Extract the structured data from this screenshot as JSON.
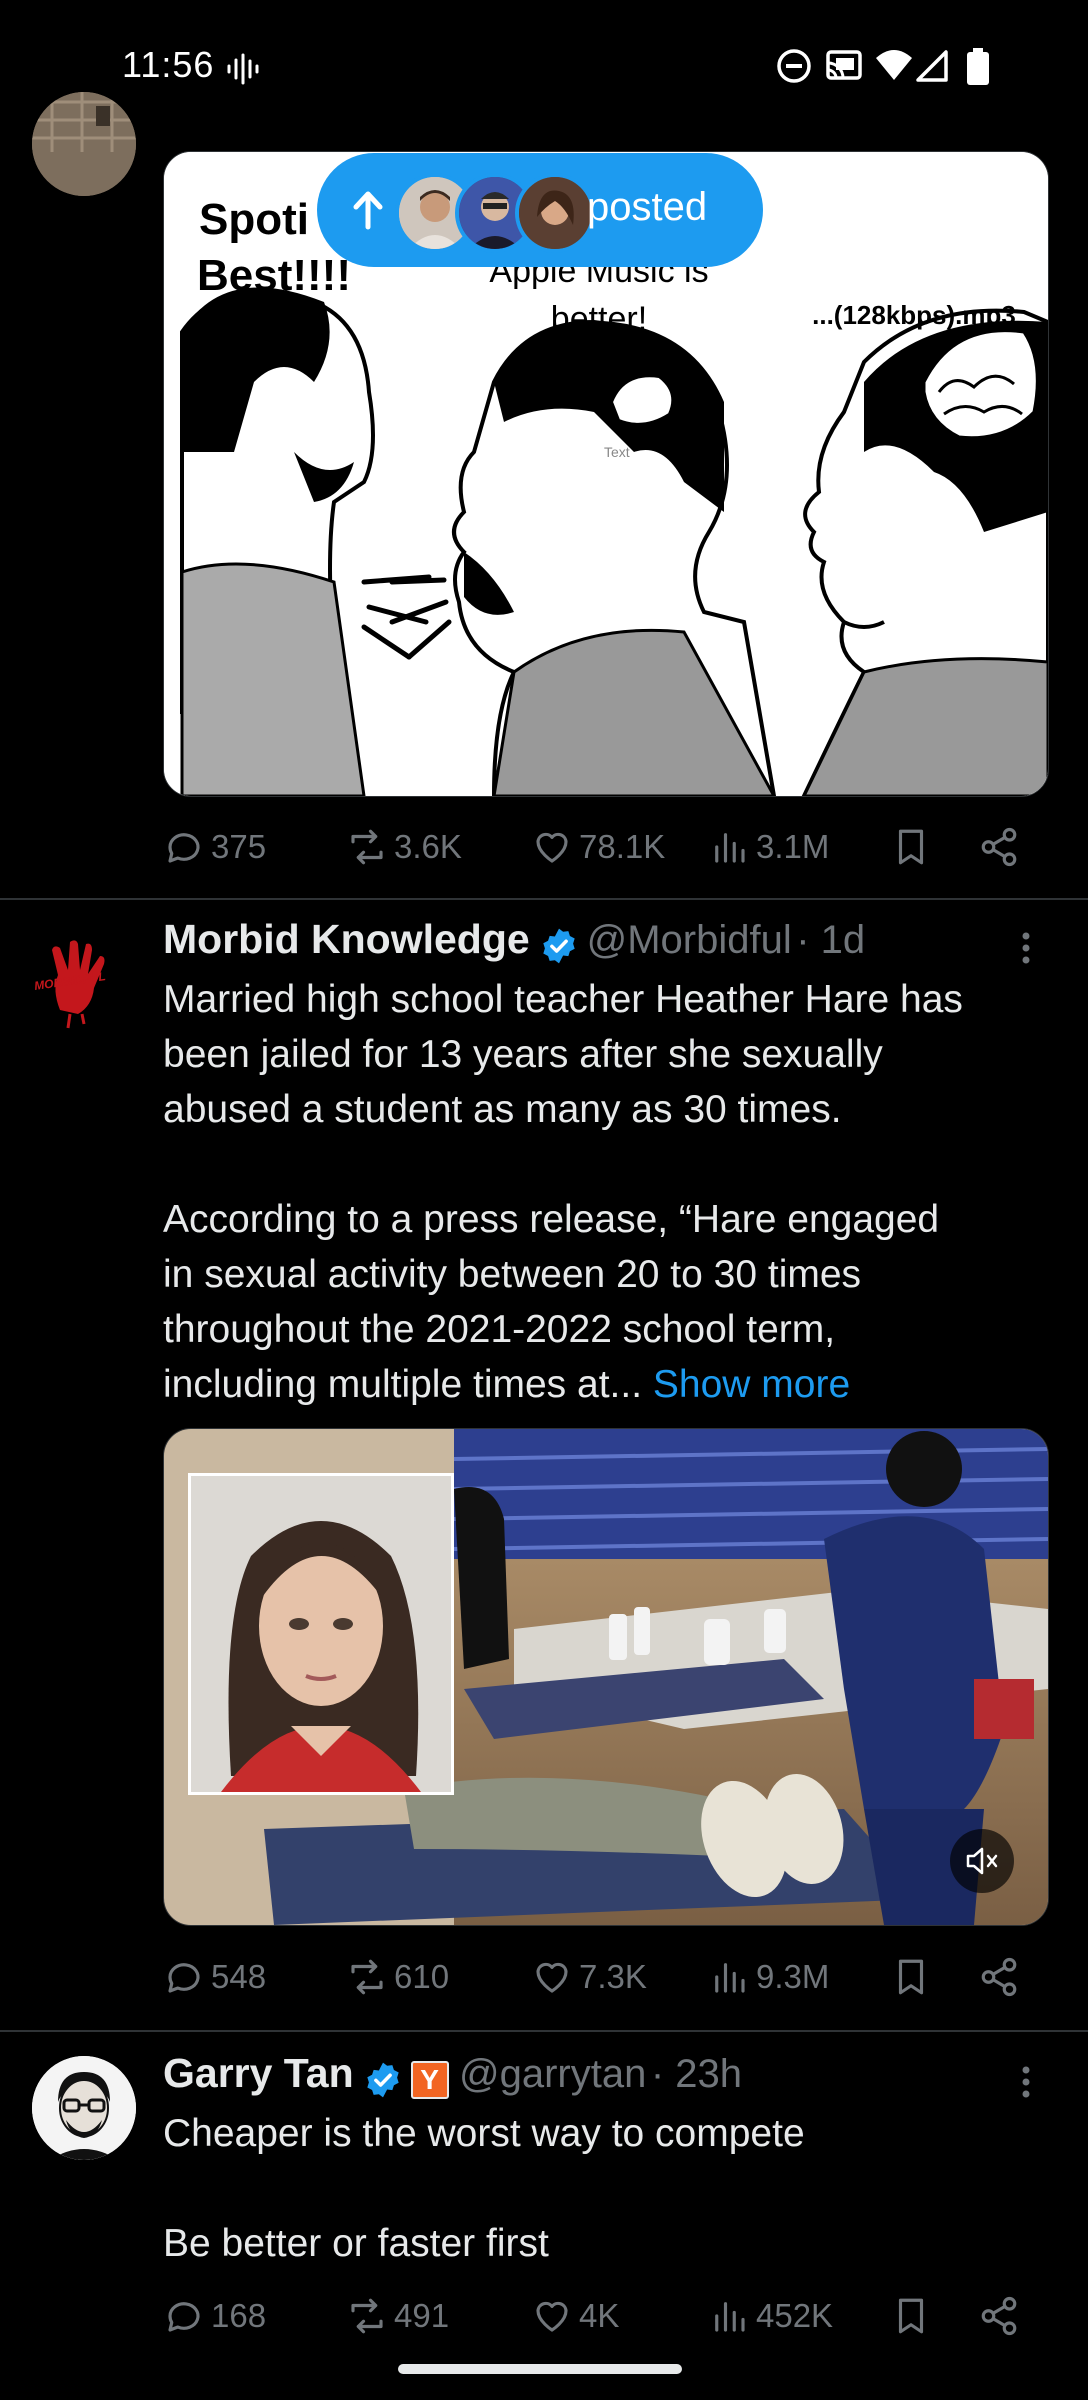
{
  "status_bar": {
    "time": "11:56"
  },
  "pill": {
    "text": "posted"
  },
  "tweet1": {
    "meme": {
      "left_text": "Spoti\nBest!!!!",
      "middle_text": "Apple Music is\nbetter!",
      "right_text": "...(128kbps).mp3",
      "tiny_text": "Text"
    },
    "actions": {
      "replies": "375",
      "reposts": "3.6K",
      "likes": "78.1K",
      "views": "3.1M"
    }
  },
  "tweet2": {
    "name": "Morbid Knowledge",
    "handle": "@Morbidful",
    "time": "1d",
    "text": "Married high school teacher Heather Hare has\nbeen jailed for 13 years after she sexually\nabused a student as many as 30 times.\n\nAccording to a press release, “Hare engaged\nin sexual activity between 20 to 30 times\nthroughout the 2021-2022 school term,\nincluding multiple times at... ",
    "show_more": "Show more",
    "avatar_text": "MORBIDFUL",
    "actions": {
      "replies": "548",
      "reposts": "610",
      "likes": "7.3K",
      "views": "9.3M"
    }
  },
  "tweet3": {
    "name": "Garry Tan",
    "handle": "@garrytan",
    "time": "23h",
    "affiliate": "Y",
    "text": "Cheaper is the worst way to compete\n\nBe better or faster first",
    "actions": {
      "replies": "168",
      "reposts": "491",
      "likes": "4K",
      "views": "452K"
    }
  },
  "colors": {
    "accent": "#1d9bf0",
    "muted": "#71767b",
    "text": "#e7e9ea",
    "divider": "#2f3336",
    "yc_orange": "#f26522"
  }
}
